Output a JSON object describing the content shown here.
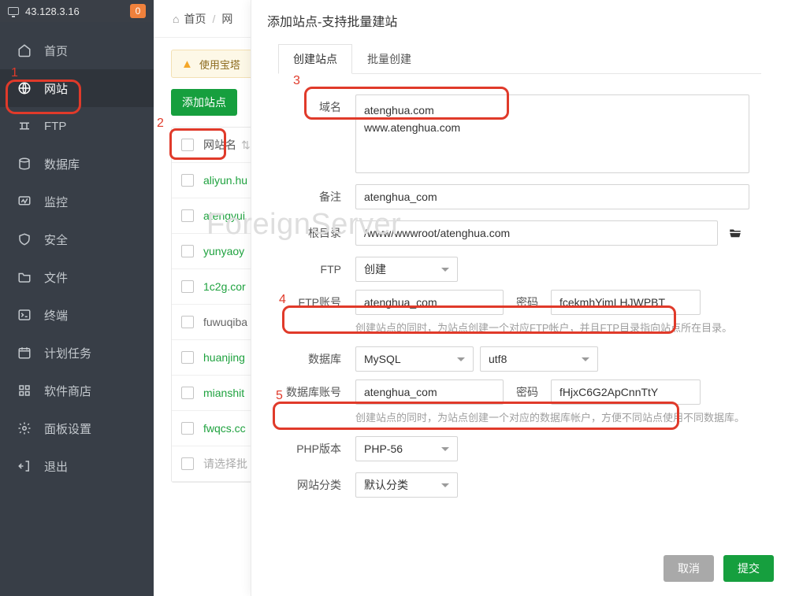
{
  "top": {
    "ip": "43.128.3.16",
    "badge": "0"
  },
  "nav": {
    "items": [
      "首页",
      "网站",
      "FTP",
      "数据库",
      "监控",
      "安全",
      "文件",
      "终端",
      "计划任务",
      "软件商店",
      "面板设置",
      "退出"
    ],
    "active_index": 1
  },
  "crumb": {
    "home": "首页",
    "section": "网"
  },
  "alert": "使用宝塔",
  "toolbar": {
    "add": "添加站点"
  },
  "table": {
    "header": "网站名",
    "rows": [
      "aliyun.hu",
      "atengyui",
      "yunyaoy",
      "1c2g.cor",
      "fuwuqiba",
      "huanjing",
      "mianshit",
      "fwqcs.cc"
    ],
    "muted_index": 4,
    "batch": "请选择批"
  },
  "modal": {
    "title": "添加站点-支持批量建站",
    "tabs": [
      "创建站点",
      "批量创建"
    ],
    "labels": {
      "domain": "域名",
      "note": "备注",
      "root": "根目录",
      "ftp": "FTP",
      "ftp_acc": "FTP账号",
      "pwd": "密码",
      "db": "数据库",
      "db_acc": "数据库账号",
      "php": "PHP版本",
      "cat": "网站分类"
    },
    "vals": {
      "domain": "atenghua.com\nwww.atenghua.com",
      "note": "atenghua_com",
      "root": "/www/wwwroot/atenghua.com",
      "ftp_sel": "创建",
      "ftp_acc": "atenghua_com",
      "ftp_pwd": "fcekmhYimLHJWPBT",
      "db_sel": "MySQL",
      "db_charset": "utf8",
      "db_acc": "atenghua_com",
      "db_pwd": "fHjxC6G2ApCnnTtY",
      "php": "PHP-56",
      "cat": "默认分类"
    },
    "hints": {
      "ftp": "创建站点的同时，为站点创建一个对应FTP帐户，并且FTP目录指向站点所在目录。",
      "db": "创建站点的同时，为站点创建一个对应的数据库帐户，方便不同站点使用不同数据库。"
    },
    "buttons": {
      "cancel": "取消",
      "ok": "提交"
    }
  },
  "annotations": {
    "a1": "1",
    "a2": "2",
    "a3": "3",
    "a4": "4",
    "a5": "5"
  },
  "watermark": "ForeignServer"
}
